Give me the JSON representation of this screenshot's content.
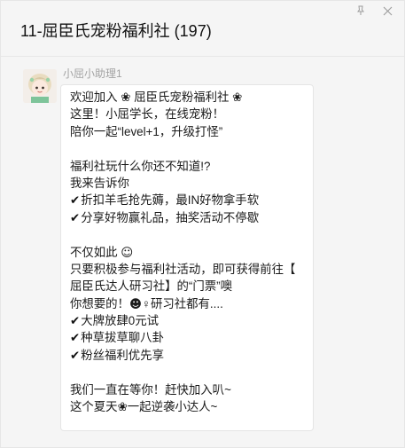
{
  "window": {
    "title": "11-屈臣氏宠粉福利社 (197)",
    "pin_icon": "pin-icon",
    "close_icon": "close-icon"
  },
  "message": {
    "sender": "小屈小助理1",
    "lines": {
      "l1a": "欢迎加入",
      "l1b": "屈臣氏宠粉福利社",
      "l2": "这里！小屈学长，在线宠粉！",
      "l3": "陪你一起“level+1，升级打怪”",
      "l5": "福利社玩什么你还不知道!?",
      "l6": "我来告诉你",
      "l7": "折扣羊毛抢先薅，最IN好物拿手软",
      "l8": "分享好物赢礼品，抽奖活动不停歇",
      "l10": "不仅如此",
      "l11": "只要积极参与福利社活动，即可获得前往【",
      "l12": "屈臣氏达人研习社】的“门票”噢",
      "l13a": "你想要的！",
      "l13b": "♀研习社都有....",
      "l14": "大牌放肆0元试",
      "l15": "种草拔草聊八卦",
      "l16": "粉丝福利优先享",
      "l18": "我们一直在等你！赶快加入叭~",
      "l19a": "这个夏天",
      "l19b": "一起逆袭小达人~"
    }
  },
  "icons": {
    "flower": "❀",
    "smile": "☺",
    "woman": "☻",
    "check": "✔"
  }
}
